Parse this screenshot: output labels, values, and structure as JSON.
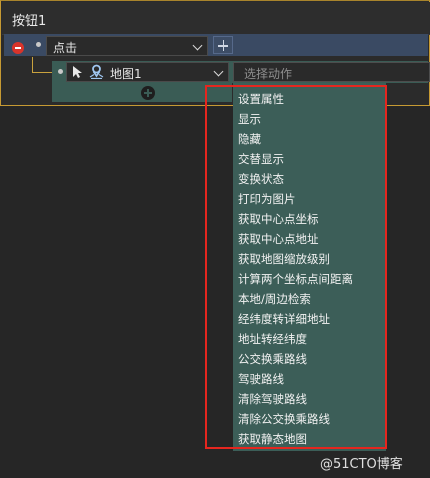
{
  "panel": {
    "title": "按钮1"
  },
  "event": {
    "selected": "点击"
  },
  "action": {
    "target_label": "地图1",
    "input_placeholder": "选择动作"
  },
  "dropdown": {
    "items": [
      "设置属性",
      "显示",
      "隐藏",
      "交替显示",
      "变换状态",
      "打印为图片",
      "获取中心点坐标",
      "获取中心点地址",
      "获取地图缩放级别",
      "计算两个坐标点间距离",
      "本地/周边检索",
      "经纬度转详细地址",
      "地址转经纬度",
      "公交换乘路线",
      "驾驶路线",
      "清除驾驶路线",
      "清除公交换乘路线",
      "获取静态地图"
    ]
  },
  "watermark": "@51CTO博客",
  "colors": {
    "panel_border": "#c69a33",
    "event_row": "#3a4a63",
    "action_row": "#3a5c55",
    "dropdown_bg": "#3c5e58",
    "highlight": "#e5261f",
    "remove": "#d9342b"
  }
}
